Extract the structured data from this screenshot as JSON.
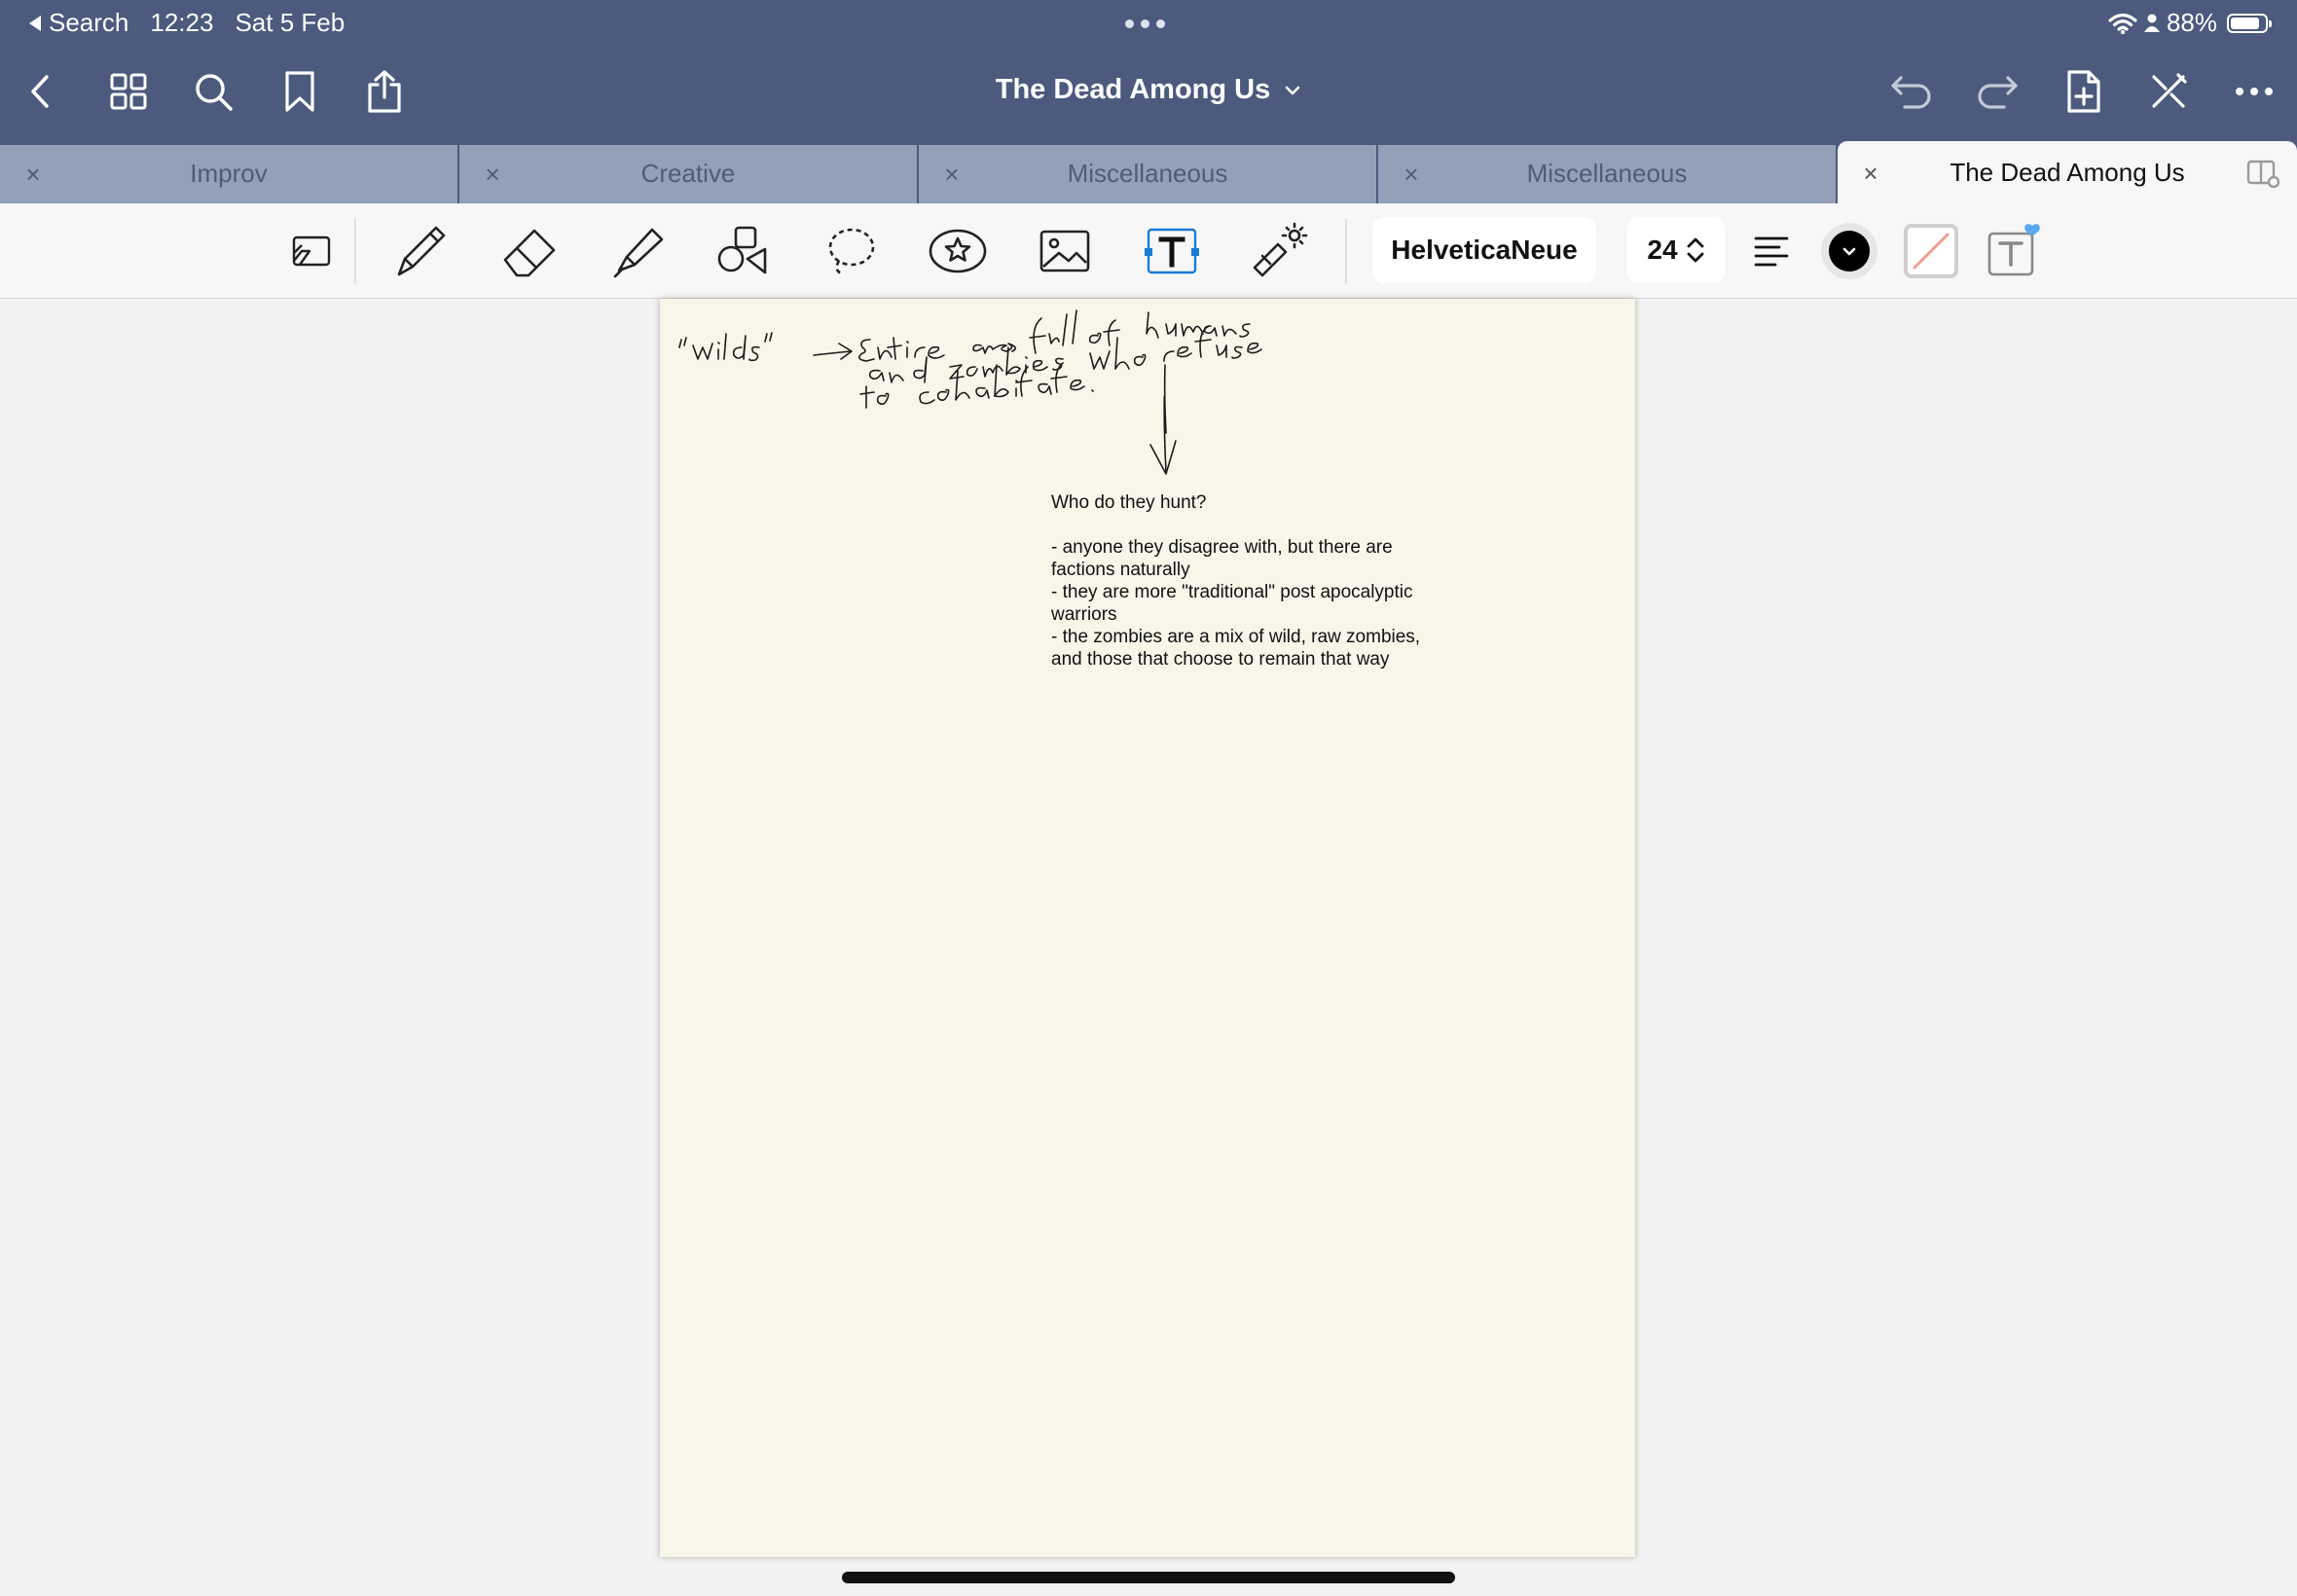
{
  "status_bar": {
    "back_label": "Search",
    "time": "12:23",
    "date": "Sat 5 Feb",
    "battery": "88%",
    "battery_level": 0.88
  },
  "nav": {
    "document_title": "The Dead Among Us",
    "left_icons": [
      "chevron-left-icon",
      "grid-icon",
      "search-icon",
      "bookmark-icon",
      "share-icon"
    ],
    "right_icons": [
      "undo-icon",
      "redo-icon",
      "add-page-icon",
      "close-pen-icon",
      "more-icon"
    ]
  },
  "tabs": [
    {
      "label": "Improv",
      "active": false
    },
    {
      "label": "Creative",
      "active": false
    },
    {
      "label": "Miscellaneous",
      "active": false
    },
    {
      "label": "Miscellaneous",
      "active": false
    },
    {
      "label": "The Dead Among Us",
      "active": true
    }
  ],
  "tab_close_glyph": "×",
  "toolbar": {
    "tools": [
      "read-only-icon",
      "pen-icon",
      "eraser-icon",
      "highlighter-icon",
      "shapes-icon",
      "lasso-icon",
      "sticker-icon",
      "image-icon",
      "text-tool-icon",
      "laser-pointer-icon"
    ],
    "active_tool": "text-tool-icon",
    "font_name": "HelveticaNeue",
    "font_size": "24",
    "text_color": "#000000",
    "accent_color": "#1a7bd6"
  },
  "handwriting": {
    "line1": "\"wilds\" → Entire areas full of humans",
    "line2": "and zombies who refuse",
    "line3": "to cohabitate."
  },
  "note": {
    "heading": "Who do they hunt?",
    "lines": [
      "- anyone they disagree with, but there are",
      "factions naturally",
      "- they are more \"traditional\" post apocalyptic",
      "warriors",
      "- the zombies are a mix of wild, raw zombies,",
      "and those that choose to remain that way"
    ]
  }
}
